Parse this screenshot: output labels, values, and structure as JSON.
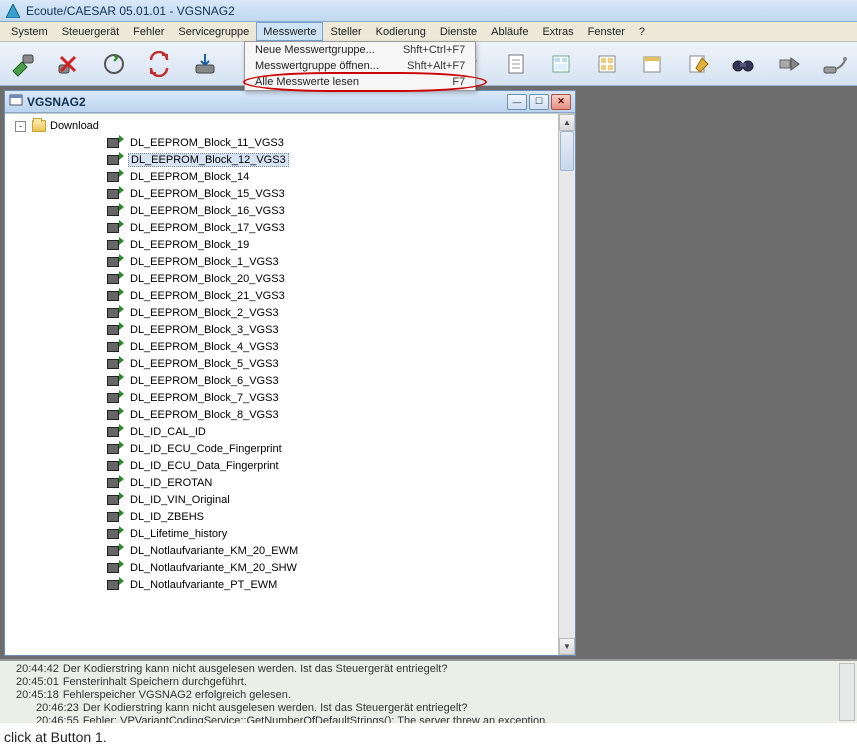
{
  "window": {
    "title": "Ecoute/CAESAR 05.01.01 - VGSNAG2"
  },
  "menubar": [
    "System",
    "Steuergerät",
    "Fehler",
    "Servicegruppe",
    "Messwerte",
    "Steller",
    "Kodierung",
    "Dienste",
    "Abläufe",
    "Extras",
    "Fenster",
    "?"
  ],
  "dropdown": {
    "items": [
      {
        "label": "Neue Messwertgruppe...",
        "shortcut": "Shft+Ctrl+F7"
      },
      {
        "label": "Messwertgruppe öffnen...",
        "shortcut": "Shft+Alt+F7"
      },
      {
        "label": "Alle Messwerte lesen",
        "shortcut": "F7"
      }
    ]
  },
  "inner": {
    "title": "VGSNAG2"
  },
  "tree": {
    "folder": "Download",
    "items": [
      "DL_EEPROM_Block_11_VGS3",
      "DL_EEPROM_Block_12_VGS3",
      "DL_EEPROM_Block_14",
      "DL_EEPROM_Block_15_VGS3",
      "DL_EEPROM_Block_16_VGS3",
      "DL_EEPROM_Block_17_VGS3",
      "DL_EEPROM_Block_19",
      "DL_EEPROM_Block_1_VGS3",
      "DL_EEPROM_Block_20_VGS3",
      "DL_EEPROM_Block_21_VGS3",
      "DL_EEPROM_Block_2_VGS3",
      "DL_EEPROM_Block_3_VGS3",
      "DL_EEPROM_Block_4_VGS3",
      "DL_EEPROM_Block_5_VGS3",
      "DL_EEPROM_Block_6_VGS3",
      "DL_EEPROM_Block_7_VGS3",
      "DL_EEPROM_Block_8_VGS3",
      "DL_ID_CAL_ID",
      "DL_ID_ECU_Code_Fingerprint",
      "DL_ID_ECU_Data_Fingerprint",
      "DL_ID_EROTAN",
      "DL_ID_VIN_Original",
      "DL_ID_ZBEHS",
      "DL_Lifetime_history",
      "DL_Notlaufvariante_KM_20_EWM",
      "DL_Notlaufvariante_KM_20_SHW",
      "DL_Notlaufvariante_PT_EWM"
    ],
    "selected_index": 1
  },
  "log": [
    {
      "time": "20:44:42",
      "msg": "Der Kodierstring kann nicht ausgelesen werden. Ist das Steuergerät entriegelt?"
    },
    {
      "time": "20:45:01",
      "msg": "Fensterinhalt Speichern durchgeführt."
    },
    {
      "time": "20:45:18",
      "msg": "Fehlerspeicher VGSNAG2 erfolgreich gelesen."
    },
    {
      "time": "20:46:23",
      "msg": "Der Kodierstring kann nicht ausgelesen werden. Ist das Steuergerät entriegelt?"
    },
    {
      "time": "20:46:55",
      "msg": "Fehler: VPVariantCodingService::GetNumberOfDefaultStrings(): The server threw an exception."
    },
    {
      "time": "20:46:55",
      "msg": "."
    }
  ],
  "caption": "click at Button 1.",
  "toolbar_icons": [
    "connect-icon",
    "disconnect-icon",
    "refresh-circle-icon",
    "refresh-swap-icon",
    "save-icon",
    "flash-icon",
    "doc-icon",
    "form-icon",
    "form2-icon",
    "cal-icon",
    "edit-icon",
    "binoculars-icon",
    "play-icon",
    "wand-icon"
  ]
}
